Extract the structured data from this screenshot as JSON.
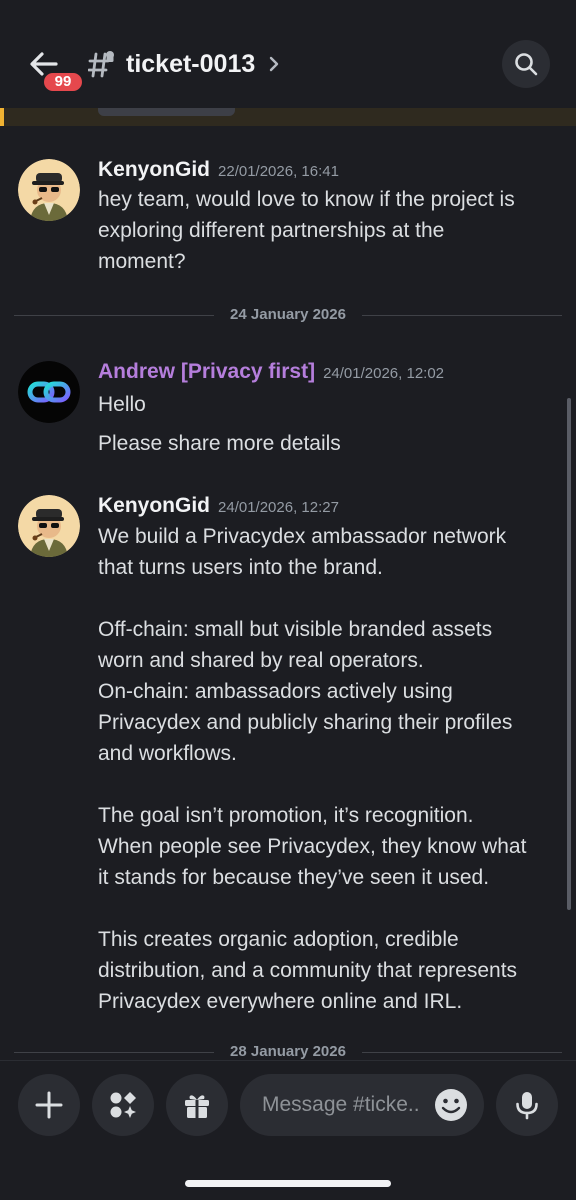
{
  "header": {
    "back_icon": "arrow-left-icon",
    "unread_badge": "99",
    "channel_icon": "thread-hash-icon",
    "channel_name": "ticket-0013",
    "chevron_icon": "chevron-right-icon",
    "search_icon": "search-icon"
  },
  "messages": [
    {
      "author": "KenyonGid",
      "timestamp": "22/01/2026, 16:41",
      "lines": [
        "hey team, would love to know if the project is",
        "exploring different partnerships at the",
        "moment?"
      ]
    },
    {
      "author": "Andrew [Privacy first]",
      "timestamp": "24/01/2026, 12:02",
      "lines": [
        "Hello",
        "Please share more details"
      ]
    },
    {
      "author": "KenyonGid",
      "timestamp": "24/01/2026, 12:27",
      "paragraphs": [
        [
          "We build a Privacydex ambassador network",
          "that turns users into the brand."
        ],
        [
          "Off-chain: small but visible branded assets",
          "worn and shared by real operators.",
          "On-chain: ambassadors actively using",
          "Privacydex and publicly sharing their profiles",
          "and workflows."
        ],
        [
          "The goal isn’t promotion, it’s recognition.",
          "When people see Privacydex, they know what",
          "it stands for because they’ve seen it used."
        ],
        [
          "This creates organic adoption, credible",
          "distribution, and a community that represents",
          "Privacydex everywhere online and IRL."
        ]
      ]
    }
  ],
  "dividers": [
    "24 January 2026",
    "28 January 2026"
  ],
  "composer": {
    "placeholder": "Message #ticke..",
    "buttons": [
      "plus-icon",
      "apps-icon",
      "gift-icon"
    ],
    "emoji_icon": "emoji-icon",
    "mic_icon": "microphone-icon"
  },
  "colors": {
    "background": "#1c1d22",
    "role_purple": "#b57edc",
    "badge_red": "#e5484d",
    "accent_yellow": "#f0b232"
  }
}
